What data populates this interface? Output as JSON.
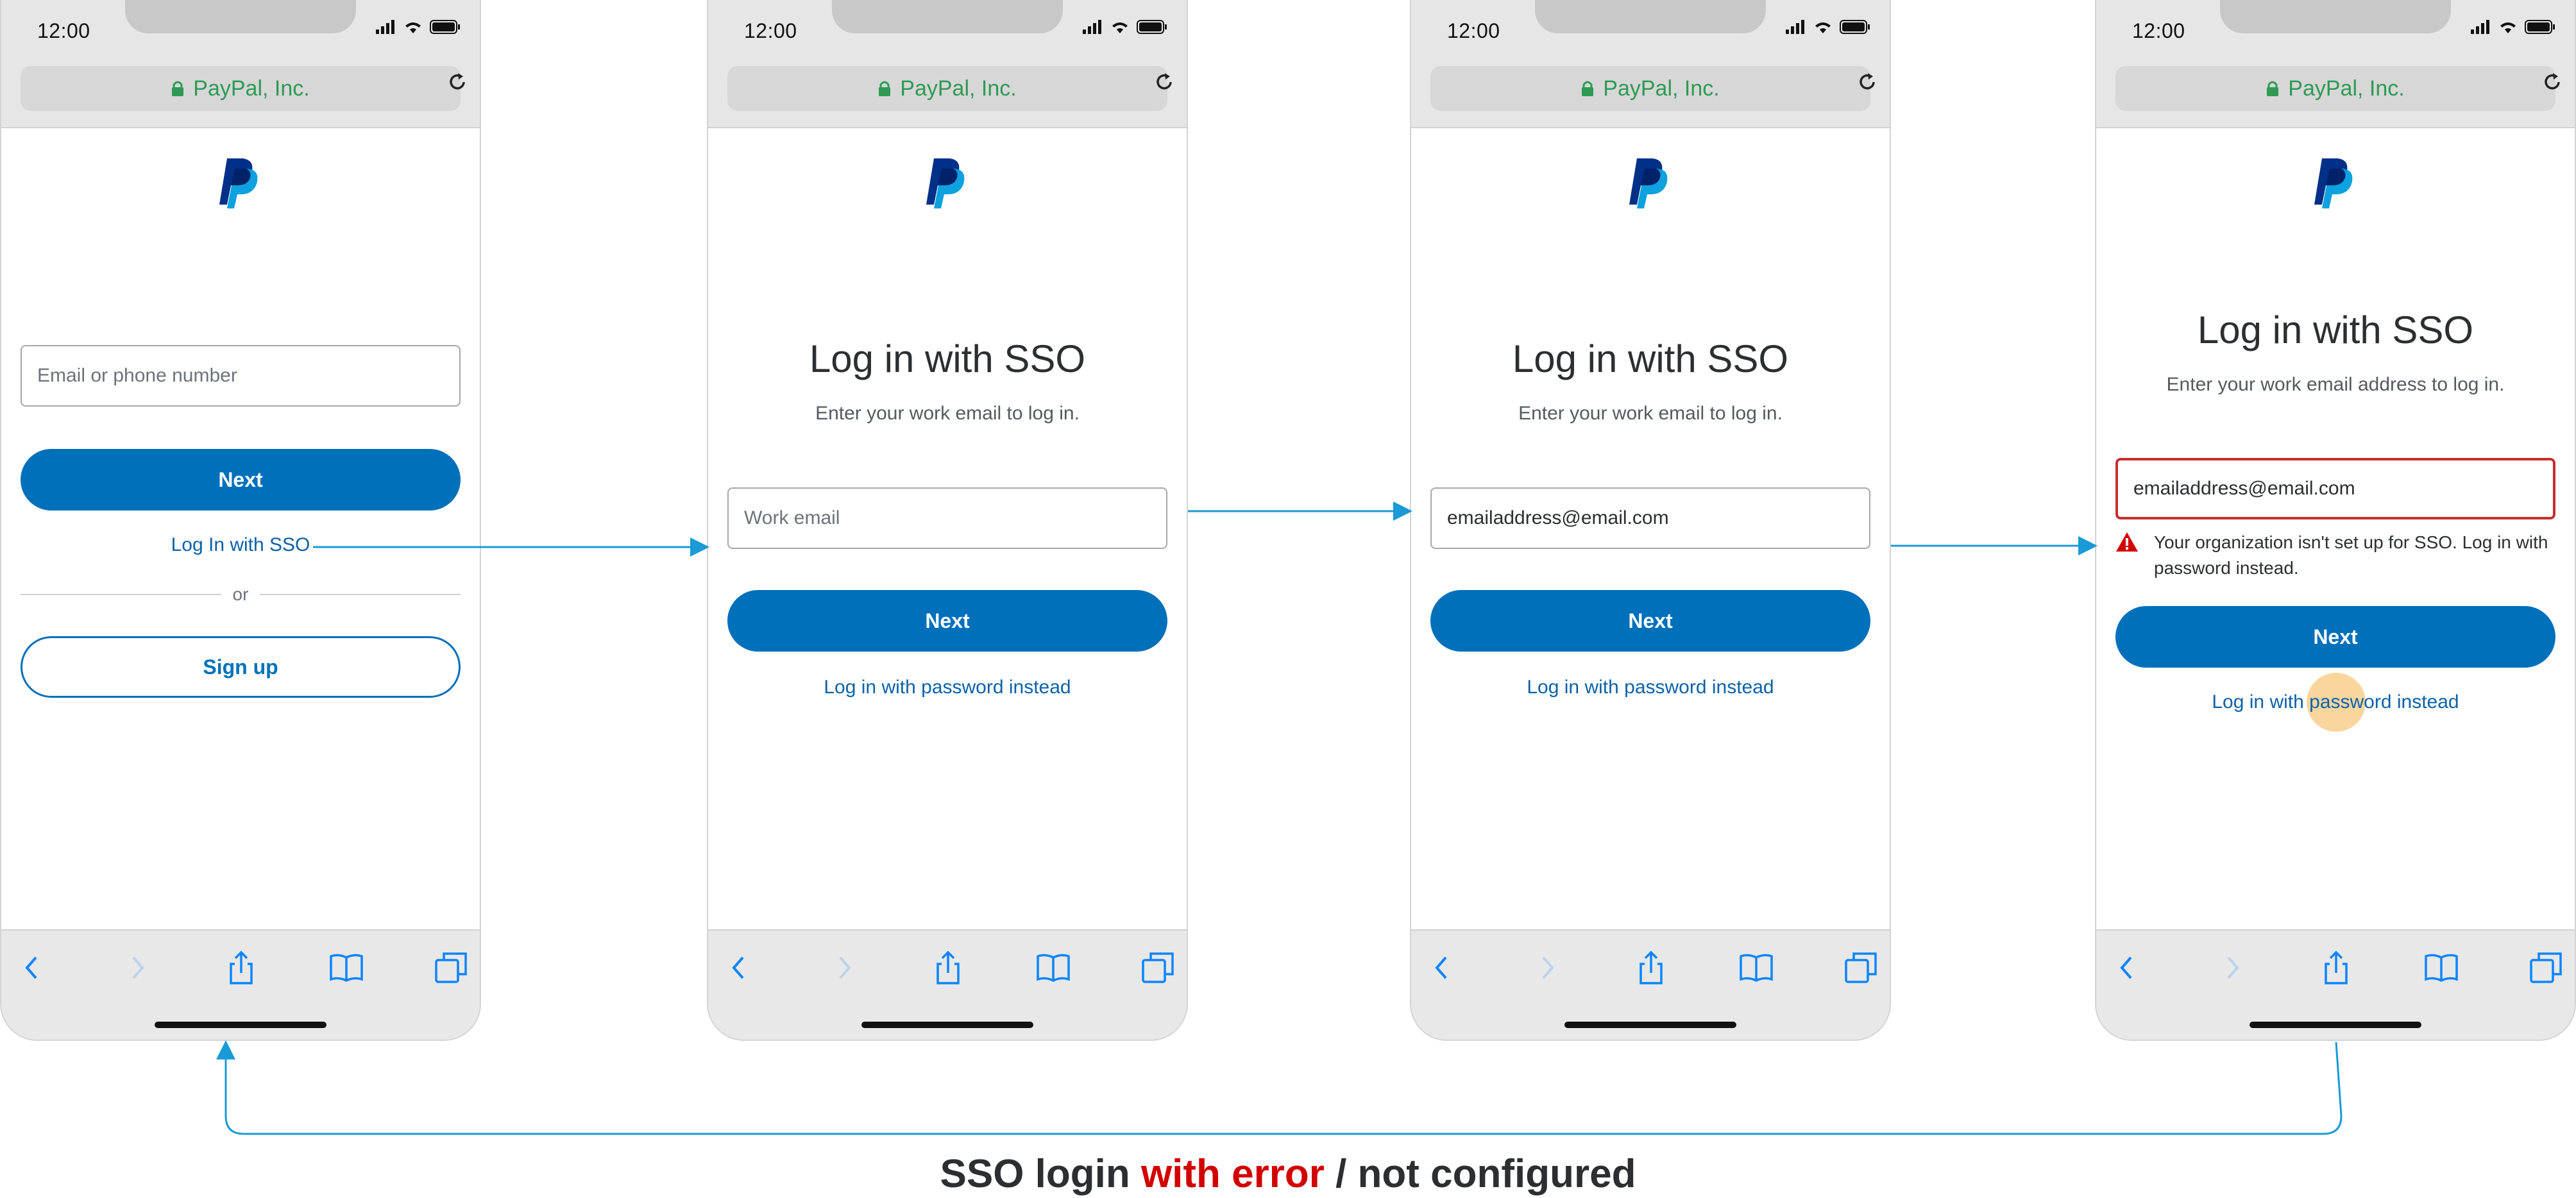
{
  "common": {
    "time": "12:00",
    "url": "PayPal, Inc."
  },
  "screen1": {
    "email_placeholder": "Email or phone number",
    "next_label": "Next",
    "sso_link": "Log In with SSO",
    "or_label": "or",
    "signup_label": "Sign up"
  },
  "screen2": {
    "title": "Log in with SSO",
    "subtitle": "Enter your work email to log in.",
    "email_placeholder": "Work email",
    "next_label": "Next",
    "password_link": "Log in with password instead"
  },
  "screen3": {
    "title": "Log in with SSO",
    "subtitle": "Enter your work email to log in.",
    "email_value": "emailaddress@email.com",
    "next_label": "Next",
    "password_link": "Log in with password instead"
  },
  "screen4": {
    "title": "Log in with SSO",
    "subtitle": "Enter your work email address to log in.",
    "email_value": "emailaddress@email.com",
    "error_message_line1": "Your organization isn't set up for SSO. Log in with",
    "error_message_line2": "password instead.",
    "next_label": "Next",
    "password_link": "Log in with password instead"
  },
  "caption": {
    "part1": "SSO login ",
    "part2": "with error",
    "part3": " / not configured"
  },
  "colors": {
    "paypal_blue": "#0070ba",
    "link_blue": "#0c62a8",
    "error_red": "#c72e2e",
    "url_green": "#2e9a54",
    "arrow_blue": "#1a9ad6"
  }
}
